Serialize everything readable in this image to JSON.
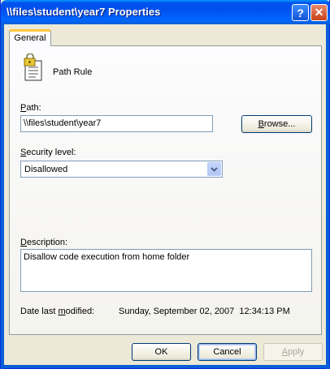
{
  "window": {
    "title": "\\\\files\\student\\year7 Properties",
    "help_glyph": "?",
    "close_glyph": "✕"
  },
  "tabs": [
    {
      "label": "General",
      "active": true
    }
  ],
  "rule": {
    "icon": "path-rule-document-lock-icon",
    "type_label": "Path Rule"
  },
  "path": {
    "label_accel": "P",
    "label_rest": "ath:",
    "value": "\\\\files\\student\\year7",
    "browse_accel": "B",
    "browse_rest": "rowse..."
  },
  "security": {
    "label_accel": "S",
    "label_rest": "ecurity level:",
    "selected": "Disallowed"
  },
  "description": {
    "label_accel": "D",
    "label_rest": "escription:",
    "value": "Disallow code execution from home folder"
  },
  "modified": {
    "label_pre": "Date last ",
    "label_accel": "m",
    "label_post": "odified:",
    "value": "Sunday, September 02, 2007  12:34:13 PM"
  },
  "buttons": {
    "ok": "OK",
    "cancel": "Cancel",
    "apply_accel": "A",
    "apply_rest": "pply"
  },
  "colors": {
    "titlebar": "#0054e3",
    "tab_highlight": "#ffc83c",
    "dialog_bg": "#ece9d8"
  }
}
